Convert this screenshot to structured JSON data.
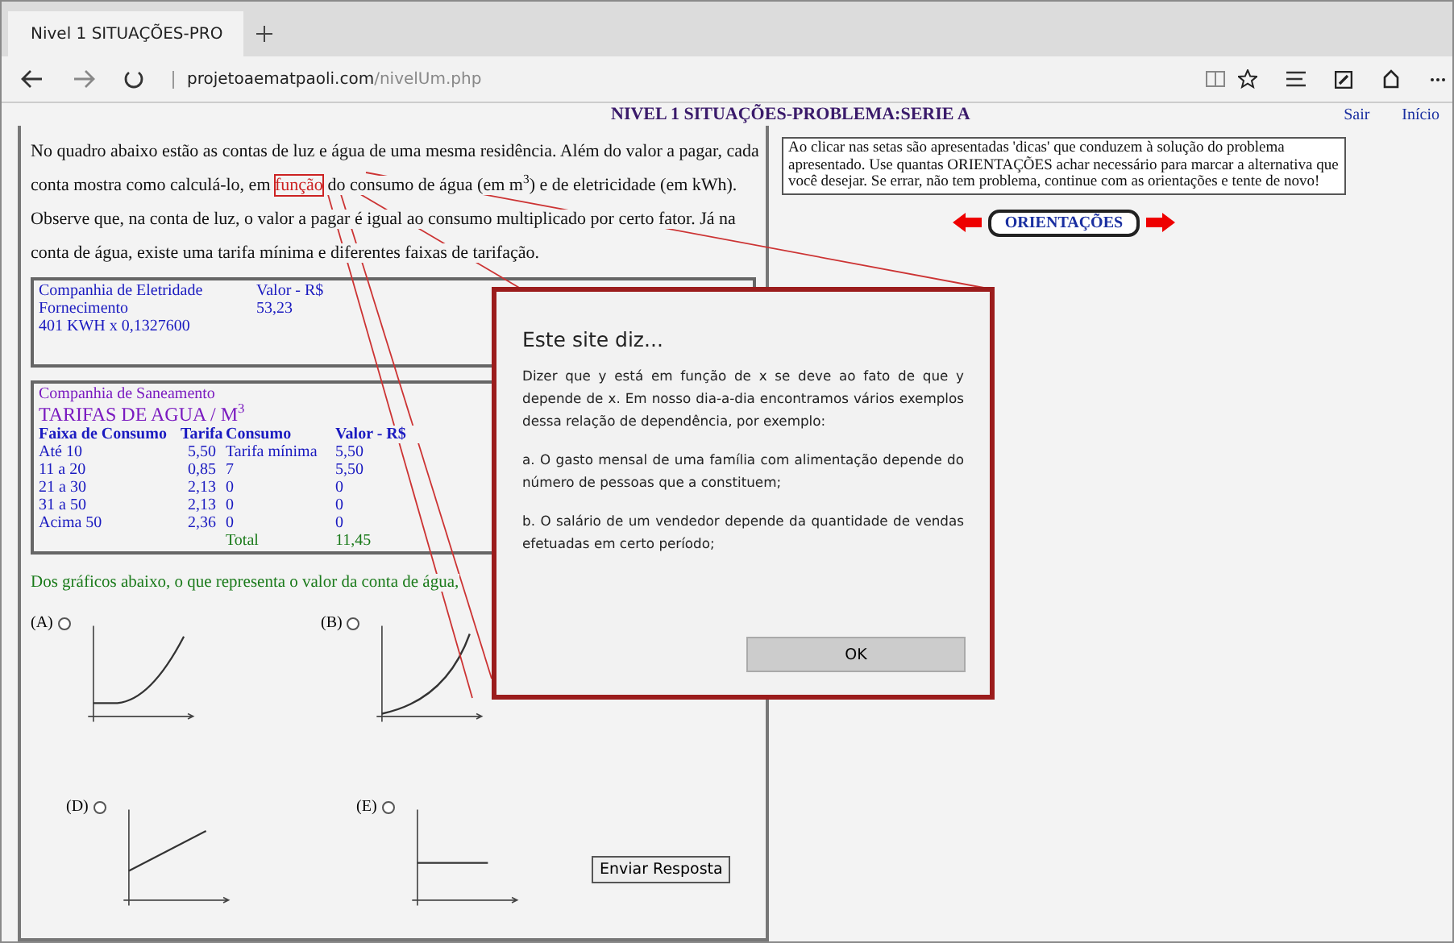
{
  "browser": {
    "tab_title": "Nivel 1 SITUAÇÕES-PRO",
    "url_host": "projetoaematpaoli.com",
    "url_path": "/nivelUm.php"
  },
  "header": {
    "title": "NIVEL 1 SITUAÇÕES-PROBLEMA:SERIE A",
    "links": [
      "Sair",
      "Início"
    ]
  },
  "intro": {
    "before": "No quadro abaixo estão as contas de luz e água de uma mesma residência.   Além do valor a pagar, cada conta mostra como calculá-lo, em ",
    "highlight": "função",
    "after": " do consumo de água (em m$^{3}$) e de eletricidade (em kWh).     Observe que, na conta de luz, o valor a pagar é igual ao consumo multiplicado por certo fator. Já na conta de água, existe uma tarifa mínima e diferentes faixas de tarifação."
  },
  "electricity_bill": {
    "rows": [
      [
        "Companhia de Eletridade",
        "Valor - R$"
      ],
      [
        "Fornecimento",
        "53,23"
      ],
      [
        "401 KWH x 0,1327600"
      ]
    ]
  },
  "water_bill": {
    "company": "Companhia de Saneamento",
    "title": "TARIFAS DE AGUA / M$^{3}$",
    "columns": [
      "Faixa de Consumo",
      "Tarifa",
      "Consumo",
      "Valor - R$"
    ],
    "rows": [
      [
        "Até 10",
        "5,50",
        "Tarifa mínima",
        "5,50"
      ],
      [
        "11 a 20",
        "0,85",
        "7",
        "5,50"
      ],
      [
        "21 a 30",
        "2,13",
        "0",
        "0"
      ],
      [
        "31 a 50",
        "2,13",
        "0",
        "0"
      ],
      [
        "Acima 50",
        "2,36",
        "0",
        "0"
      ]
    ],
    "total": {
      "label": "Total",
      "value": "11,45"
    }
  },
  "question": "Dos gráficos abaixo, o que representa o valor da conta de água,",
  "options": [
    {
      "label": "(A)",
      "selected": false,
      "kind": "step"
    },
    {
      "label": "(B)",
      "selected": false,
      "kind": "curve"
    },
    {
      "label": "(D)",
      "selected": false,
      "kind": "line"
    },
    {
      "label": "(E)",
      "selected": false,
      "kind": "flat"
    }
  ],
  "submit_button": "Enviar Resposta",
  "hint_box": "Ao clicar nas setas são apresentadas 'dicas' que conduzem à solução do problema apresentado. Use quantas ORIENTAÇÕES achar necessário para marcar a alternativa que você desejar. Se errar, não tem problema, continue com as orientações e tente de novo!",
  "orientations_button": "ORIENTAÇÕES",
  "dialog": {
    "title": "Este site diz...",
    "paragraphs": [
      "Dizer que y está em função de x se deve ao fato de que y depende de x. Em nosso dia-a-dia encontramos vários exemplos dessa relação de dependência, por exemplo:",
      "a. O gasto mensal de uma família com alimentação depende do número de pessoas que a constituem;",
      "b. O salário de um vendedor depende da quantidade de vendas efetuadas em certo período;"
    ],
    "button": "OK"
  }
}
